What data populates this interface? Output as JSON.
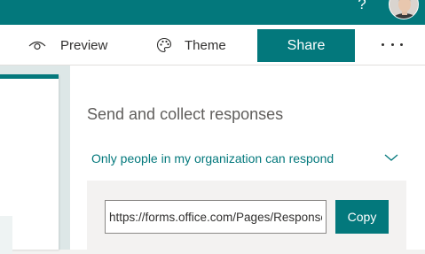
{
  "header": {
    "help_icon": "?",
    "accent_color": "#03787c"
  },
  "toolbar": {
    "preview_label": "Preview",
    "theme_label": "Theme",
    "share_label": "Share"
  },
  "send_panel": {
    "title": "Send and collect responses",
    "audience_option": "Only people in my organization can respond",
    "link_value": "https://forms.office.com/Pages/ResponsePage.aspx",
    "copy_label": "Copy"
  },
  "icons": [
    "help-icon",
    "eye-icon",
    "palette-icon",
    "more-icon",
    "chevron-down-icon"
  ]
}
